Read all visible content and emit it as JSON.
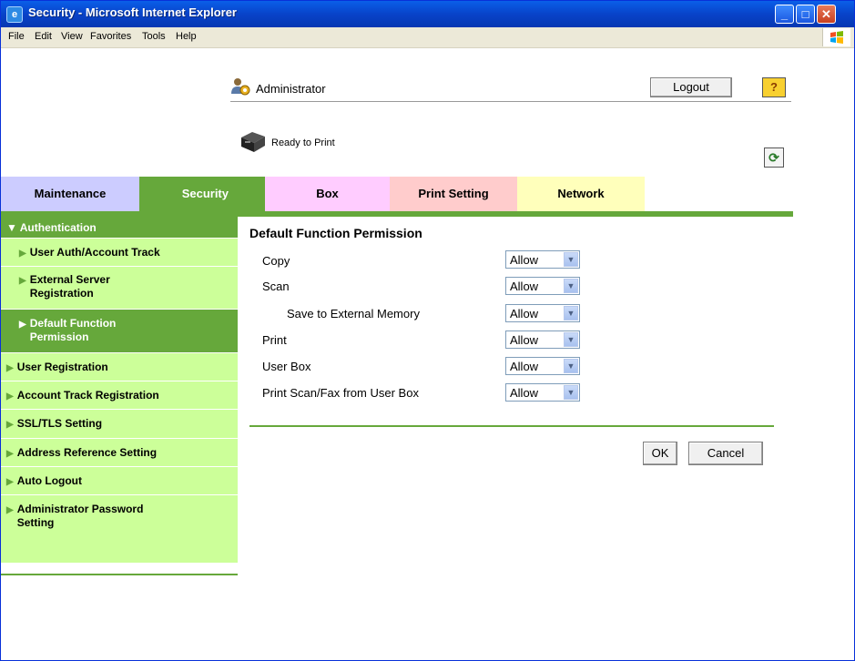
{
  "window": {
    "title": "Security - Microsoft Internet Explorer",
    "buttons": {
      "minimize": "_",
      "maximize": "□",
      "close": "✕"
    }
  },
  "menubar": {
    "items": [
      "File",
      "Edit",
      "View",
      "Favorites",
      "Tools",
      "Help"
    ]
  },
  "header": {
    "user": "Administrator",
    "logout_label": "Logout",
    "help_label": "?",
    "status": "Ready to Print",
    "refresh_label": "⟳"
  },
  "tabs": [
    {
      "label": "Maintenance",
      "color": "#ccccff"
    },
    {
      "label": "Security",
      "color": "#66a83b",
      "active": true
    },
    {
      "label": "Box",
      "color": "#ffccff"
    },
    {
      "label": "Print Setting",
      "color": "#ffcccc"
    },
    {
      "label": "Network",
      "color": "#ffffbb"
    }
  ],
  "sidebar": {
    "items": [
      {
        "label": "Authentication",
        "level": "top",
        "expanded": true
      },
      {
        "label": "User Auth/Account Track",
        "level": "sub"
      },
      {
        "label": "External Server Registration",
        "level": "sub"
      },
      {
        "label": "Default Function Permission",
        "level": "sub",
        "active": true
      },
      {
        "label": "User Registration",
        "level": "main"
      },
      {
        "label": "Account Track Registration",
        "level": "main"
      },
      {
        "label": "SSL/TLS Setting",
        "level": "main"
      },
      {
        "label": "Address Reference Setting",
        "level": "main"
      },
      {
        "label": "Auto Logout",
        "level": "main"
      },
      {
        "label": "Administrator Password Setting",
        "level": "main"
      }
    ]
  },
  "main": {
    "title": "Default Function Permission",
    "permissions": [
      {
        "label": "Copy",
        "value": "Allow"
      },
      {
        "label": "Scan",
        "value": "Allow"
      },
      {
        "label": "Save to External Memory",
        "value": "Allow"
      },
      {
        "label": "Print",
        "value": "Allow"
      },
      {
        "label": "User Box",
        "value": "Allow"
      },
      {
        "label": "Print Scan/Fax from User Box",
        "value": "Allow"
      }
    ],
    "ok_label": "OK",
    "cancel_label": "Cancel"
  },
  "colors": {
    "accent": "#66a83b",
    "sidebar_light": "#ccff99"
  }
}
